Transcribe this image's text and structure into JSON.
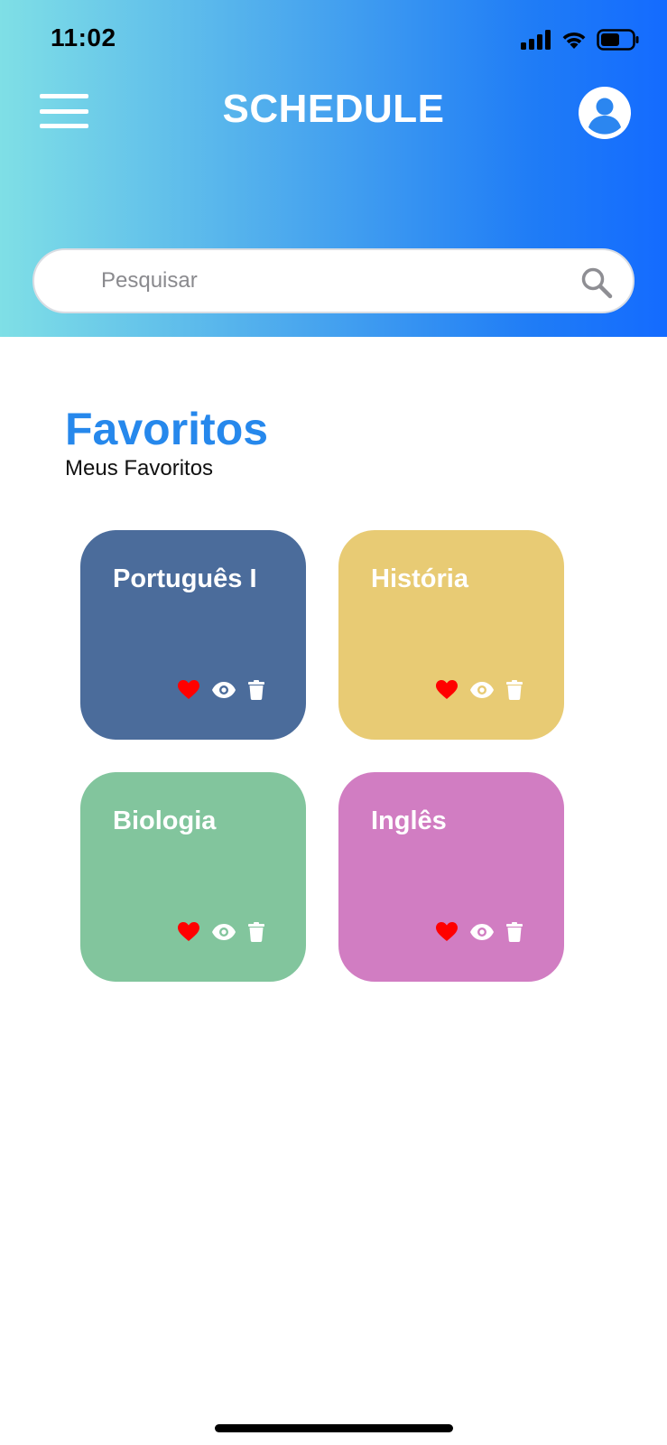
{
  "status_bar": {
    "time": "11:02",
    "icons": [
      "signal-icon",
      "wifi-icon",
      "battery-icon"
    ]
  },
  "header": {
    "title": "SCHEDULE",
    "menu_icon": "hamburger-menu-icon",
    "profile_icon": "user-profile-icon",
    "gradient": [
      "#7fdfe6",
      "#146bff"
    ]
  },
  "search": {
    "placeholder": "Pesquisar",
    "value": "",
    "icon": "search-icon"
  },
  "favorites": {
    "title": "Favoritos",
    "subtitle": "Meus Favoritos",
    "title_color": "#2688ec",
    "cards": [
      {
        "title": "Português I",
        "color": "#4b6c9b",
        "favorited": true
      },
      {
        "title": "História",
        "color": "#e8cb74",
        "favorited": true
      },
      {
        "title": "Biologia",
        "color": "#82c59d",
        "favorited": true
      },
      {
        "title": "Inglês",
        "color": "#d17dc2",
        "favorited": true
      }
    ],
    "card_icons": [
      "heart-icon",
      "eye-icon",
      "trash-icon"
    ],
    "heart_color": "#ff0000"
  }
}
